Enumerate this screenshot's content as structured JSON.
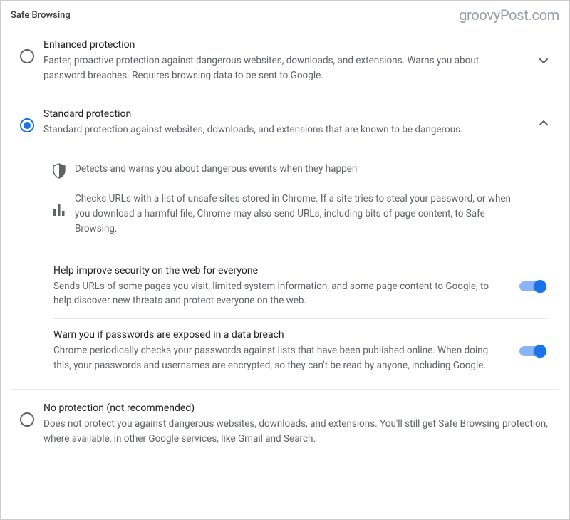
{
  "header": {
    "section_title": "Safe Browsing",
    "watermark": "groovyPost.com"
  },
  "options": {
    "enhanced": {
      "title": "Enhanced protection",
      "desc": "Faster, proactive protection against dangerous websites, downloads, and extensions. Warns you about password breaches. Requires browsing data to be sent to Google.",
      "selected": "false",
      "expanded": "false"
    },
    "standard": {
      "title": "Standard protection",
      "desc": "Standard protection against websites, downloads, and extensions that are known to be dangerous.",
      "selected": "true",
      "expanded": "true",
      "feature1": "Detects and warns you about dangerous events when they happen",
      "feature2": "Checks URLs with a list of unsafe sites stored in Chrome. If a site tries to steal your password, or when you download a harmful file, Chrome may also send URLs, including bits of page content, to Safe Browsing.",
      "toggle1": {
        "title": "Help improve security on the web for everyone",
        "desc": "Sends URLs of some pages you visit, limited system information, and some page content to Google, to help discover new threats and protect everyone on the web.",
        "on": "true"
      },
      "toggle2": {
        "title": "Warn you if passwords are exposed in a data breach",
        "desc": "Chrome periodically checks your passwords against lists that have been published online. When doing this, your passwords and usernames are encrypted, so they can't be read by anyone, including Google.",
        "on": "true"
      }
    },
    "none": {
      "title": "No protection (not recommended)",
      "desc": "Does not protect you against dangerous websites, downloads, and extensions. You'll still get Safe Browsing protection, where available, in other Google services, like Gmail and Search.",
      "selected": "false"
    }
  }
}
